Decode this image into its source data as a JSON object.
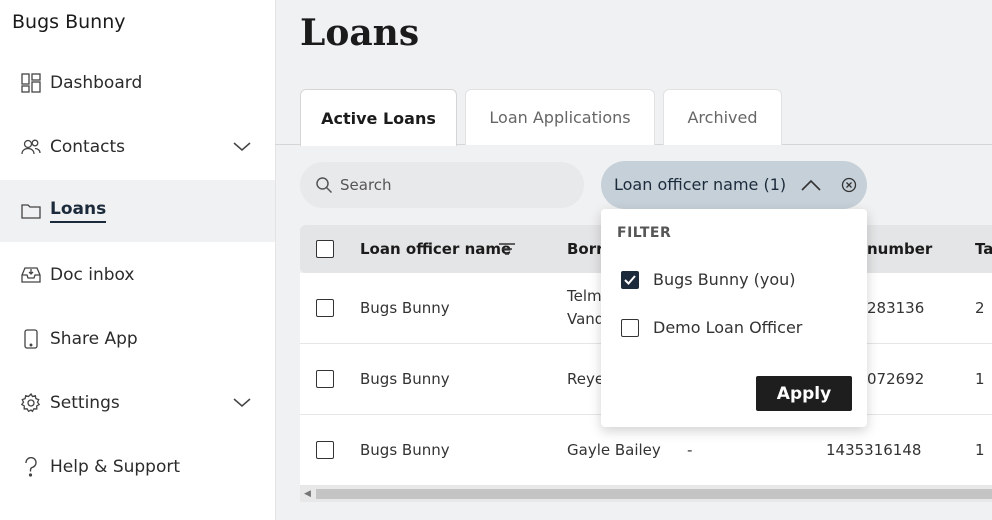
{
  "sidebar": {
    "user_name": "Bugs Bunny",
    "items": [
      {
        "label": "Dashboard",
        "icon": "dashboard-icon"
      },
      {
        "label": "Contacts",
        "icon": "contacts-icon",
        "expandable": true
      },
      {
        "label": "Loans",
        "icon": "folder-icon",
        "active": true
      },
      {
        "label": "Doc inbox",
        "icon": "inbox-icon"
      },
      {
        "label": "Share App",
        "icon": "phone-icon"
      },
      {
        "label": "Settings",
        "icon": "gear-icon",
        "expandable": true
      },
      {
        "label": "Help & Support",
        "icon": "help-icon"
      }
    ]
  },
  "main": {
    "title": "Loans",
    "tabs": [
      {
        "label": "Active Loans",
        "active": true
      },
      {
        "label": "Loan Applications"
      },
      {
        "label": "Archived"
      }
    ],
    "search": {
      "placeholder": "Search"
    },
    "filter_chip": {
      "label": "Loan officer name (1)"
    }
  },
  "table": {
    "headers": [
      "Loan officer name",
      "Borro",
      "number",
      "Ta"
    ],
    "rows": [
      {
        "officer": "Bugs Bunny",
        "borrower": [
          "Telm",
          "Vand"
        ],
        "co_borrower": "",
        "number": "283136",
        "tasks": "2"
      },
      {
        "officer": "Bugs Bunny",
        "borrower": [
          "Reye"
        ],
        "co_borrower": "",
        "number": "072692",
        "tasks": "1"
      },
      {
        "officer": "Bugs Bunny",
        "borrower": [
          "Gayle Bailey"
        ],
        "co_borrower": "-",
        "number": "1435316148",
        "tasks": "1"
      }
    ]
  },
  "filter_dropdown": {
    "heading": "FILTER",
    "options": [
      {
        "label": "Bugs Bunny (you)",
        "checked": true
      },
      {
        "label": "Demo Loan Officer",
        "checked": false
      }
    ],
    "apply_label": "Apply"
  },
  "colors": {
    "accent": "#1b2b3b",
    "chip_bg": "#c6d0d8",
    "apply_bg": "#1e1e1e"
  }
}
